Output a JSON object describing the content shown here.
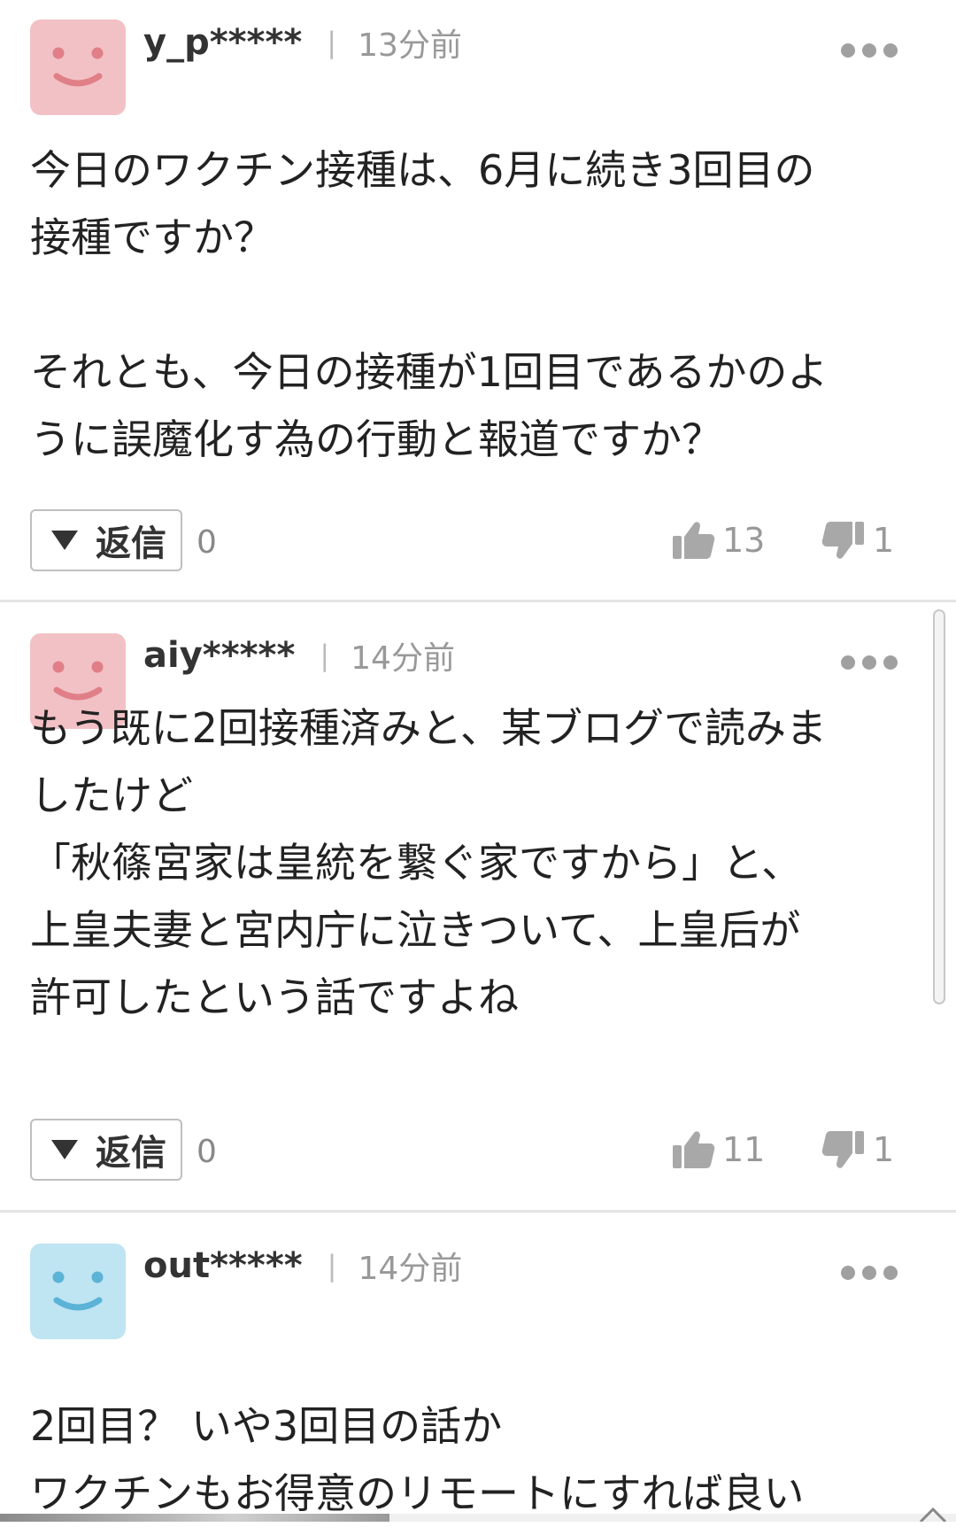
{
  "comments": [
    {
      "username": "y_p*****",
      "time": "13分前",
      "avatar_color": "#f2c1c5",
      "face_color": "#e07f87",
      "text": "今日のワクチン接種は、6月に続き3回目の\n接種ですか？\n\nそれとも、今日の接種が1回目であるかのよ\nうに誤魔化す為の行動と報道ですか？",
      "reply_label": "返信",
      "reply_count": "0",
      "likes": "13",
      "dislikes": "1"
    },
    {
      "username": "aiy*****",
      "time": "14分前",
      "avatar_color": "#f2c1c5",
      "face_color": "#e07f87",
      "text": "もう既に2回接種済みと、某ブログで読みま\nしたけど\n「秋篠宮家は皇統を繋ぐ家ですから」と、\n上皇夫妻と宮内庁に泣きついて、上皇后が\n許可したという話ですよね",
      "reply_label": "返信",
      "reply_count": "0",
      "likes": "11",
      "dislikes": "1"
    },
    {
      "username": "out*****",
      "time": "14分前",
      "avatar_color": "#bfe4f2",
      "face_color": "#5bb3d6",
      "text": "2回目？ いや3回目の話か\nワクチンもお得意のリモートにすれば良い"
    }
  ],
  "separator_label": "|",
  "icons": {
    "more": "more-options-icon",
    "like": "thumbs-up-icon",
    "dislike": "thumbs-down-icon",
    "reply_toggle": "triangle-down-icon",
    "avatar": "smiley-avatar-icon"
  },
  "colors": {
    "text": "#222222",
    "meta": "#999999",
    "icon_gray": "#a8a8a8",
    "separator": "#e4e4e4"
  }
}
